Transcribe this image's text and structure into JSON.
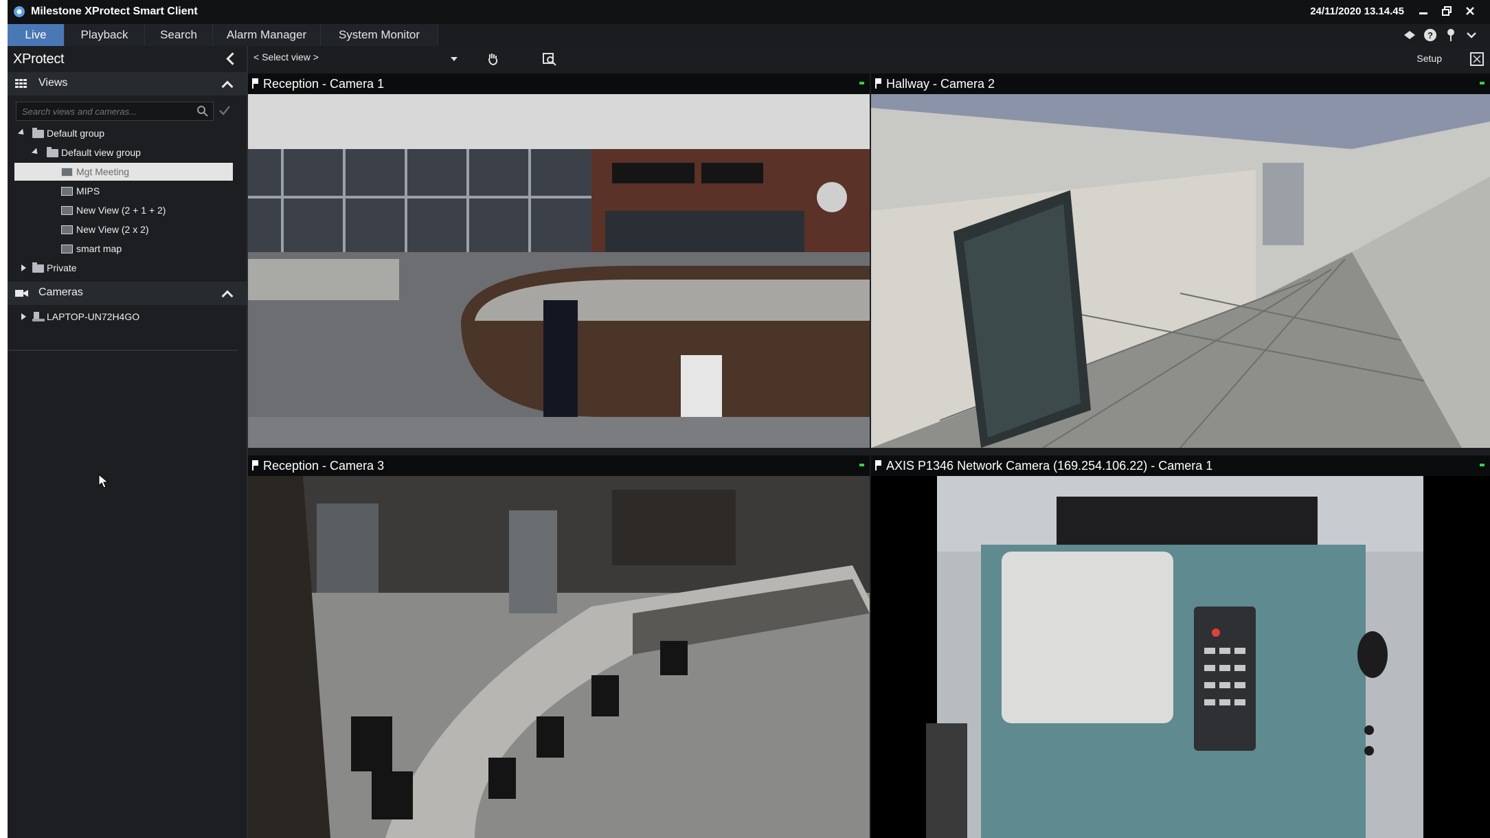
{
  "app": {
    "title": "Milestone XProtect Smart Client",
    "datetime": "24/11/2020 13.14.45"
  },
  "tabs": [
    {
      "label": "Live",
      "active": true
    },
    {
      "label": "Playback",
      "active": false
    },
    {
      "label": "Search",
      "active": false
    },
    {
      "label": "Alarm Manager",
      "active": false
    },
    {
      "label": "System Monitor",
      "active": false
    }
  ],
  "sidebar": {
    "header": "XProtect",
    "views": {
      "label": "Views",
      "search_placeholder": "Search views and cameras...",
      "tree": [
        {
          "label": "Default group"
        },
        {
          "label": "Default view group"
        },
        {
          "label": "Mgt Meeting",
          "selected": true
        },
        {
          "label": "MIPS"
        },
        {
          "label": "New View (2 + 1 + 2)"
        },
        {
          "label": "New View (2 x 2)"
        },
        {
          "label": "smart map"
        },
        {
          "label": "Private"
        }
      ]
    },
    "cameras": {
      "label": "Cameras",
      "tree": [
        {
          "label": "LAPTOP-UN72H4GO"
        }
      ]
    }
  },
  "viewbar": {
    "select_view": "< Select view >",
    "setup": "Setup"
  },
  "cameras": [
    {
      "name": "Reception - Camera 1"
    },
    {
      "name": "Hallway - Camera 2"
    },
    {
      "name": "Reception - Camera 3"
    },
    {
      "name": "AXIS P1346 Network Camera (169.254.106.22) - Camera 1",
      "selected": true
    }
  ],
  "colors": {
    "accent": "#4a78b5",
    "status_led": "#33d04a",
    "background": "#1b1d20"
  },
  "icons": [
    "milestone-logo-icon",
    "minimize-icon",
    "restore-icon",
    "close-icon",
    "pin-icon",
    "help-icon",
    "status-icon",
    "chevron-down-icon",
    "grid-icon",
    "camera-icon",
    "search-icon",
    "filter-icon",
    "server-icon",
    "hand-tool-icon",
    "search-view-icon",
    "fullscreen-icon"
  ]
}
